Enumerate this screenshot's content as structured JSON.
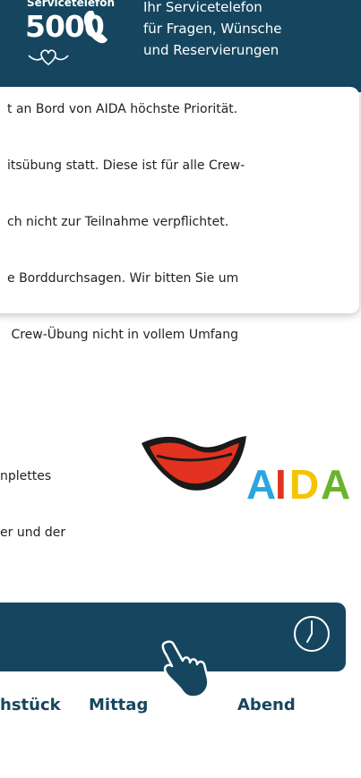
{
  "service": {
    "small_label": "Servicetelefon",
    "number": "5000",
    "description_lines": [
      "Ihr Servicetelefon",
      "für Fragen, Wünsche",
      "und Reservierungen"
    ]
  },
  "notice": {
    "lines": [
      "t an Bord von AIDA höchste Priorität.",
      "itsübung statt. Diese ist für alle Crew-",
      "ch nicht zur Teilnahme verpflichtet.",
      "e Borddurchsagen. Wir bitten Sie um",
      " Crew-Übung nicht in vollem Umfang"
    ]
  },
  "info": {
    "lines": [
      "nplettes",
      "er und der"
    ]
  },
  "logo": {
    "text": "AIDA"
  },
  "meal_tabs": [
    "hstück",
    "Mittag",
    "Abend"
  ],
  "colors": {
    "navy": "#16465f",
    "lip_red": "#e3321f",
    "logo_blue": "#2ba6de",
    "logo_yellow": "#f5c400",
    "logo_green": "#6ab42d"
  }
}
